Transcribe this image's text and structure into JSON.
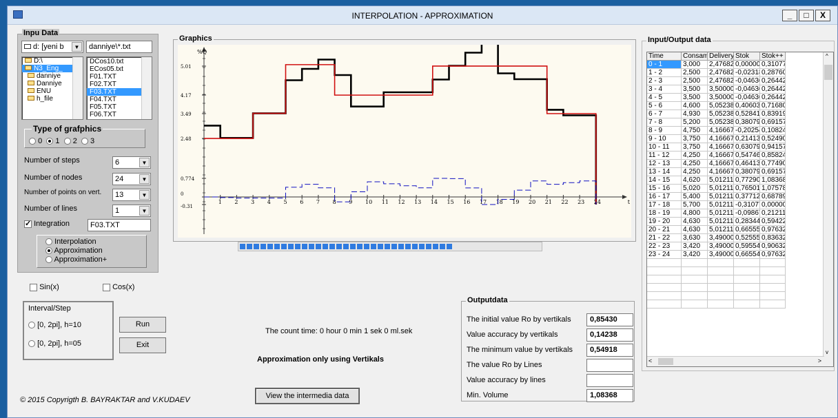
{
  "window": {
    "title": "INTERPOLATION - APPROXIMATION",
    "minimize": "_",
    "maximize": "□",
    "close": "X"
  },
  "input_data": {
    "label": "Inpu Data",
    "drive": "d: [yeni b",
    "filter": "danniye\\*.txt",
    "folders": [
      "D:\\",
      "N3_Eng_",
      "danniye",
      "Danniye",
      "ENU",
      "h_file"
    ],
    "files": [
      "DCos10.txt",
      "ECos05.txt",
      "F01.TXT",
      "F02.TXT",
      "F03.TXT",
      "F04.TXT",
      "F05.TXT",
      "F06.TXT"
    ],
    "selected_file": "F03.TXT",
    "type_label": "Type of grafphics",
    "type_options": [
      "0",
      "1",
      "2",
      "3"
    ],
    "type_selected": "1",
    "steps_label": "Number of steps",
    "steps_value": "6",
    "nodes_label": "Number of nodes",
    "nodes_value": "24",
    "points_label": "Number of points on vert.",
    "points_value": "13",
    "lines_label": "Number of lines",
    "lines_value": "1",
    "integration_label": "Integration",
    "integration_file": "F03.TXT",
    "mode_options": [
      "Interpolation",
      "Approximation",
      "Approximation+"
    ],
    "mode_selected": "Approximation"
  },
  "sin_label": "Sin(x)",
  "cos_label": "Cos(x)",
  "interval": {
    "label": "Interval/Step",
    "options": [
      "[0, 2pi],  h=10",
      "[0, 2pi],  h=05"
    ]
  },
  "run_label": "Run",
  "exit_label": "Exit",
  "count_time": "The count time: 0 hour 0 min 1 sek 0 ml.sek",
  "mode_note": "Approximation only using Vertikals",
  "copyright": "© 2015 Copyrigth B. BAYRAKTAR and V.KUDAEV",
  "view_button": "View the intermedia data",
  "progress": {
    "segments": 31,
    "fraction": 0.71
  },
  "graphics": {
    "label": "Graphics",
    "y_unit": "%Q",
    "y_ticks": [
      "5.01",
      "4.17",
      "3.49",
      "2.48",
      "0.774",
      "0",
      "-0.31"
    ],
    "x_ticks": [
      "1",
      "2",
      "3",
      "4",
      "5",
      "6",
      "7",
      "8",
      "9",
      "10",
      "11",
      "12",
      "13",
      "14",
      "15",
      "16",
      "17",
      "18",
      "19",
      "20",
      "21",
      "22",
      "23",
      "24"
    ],
    "x_unit": "t"
  },
  "chart_data": {
    "type": "line",
    "x": [
      0,
      1,
      2,
      3,
      4,
      5,
      6,
      7,
      8,
      9,
      10,
      11,
      12,
      13,
      14,
      15,
      16,
      17,
      18,
      19,
      20,
      21,
      22,
      23,
      24
    ],
    "y_ticks": [
      5.01,
      4.17,
      3.49,
      2.48,
      0.774,
      0,
      -0.31
    ],
    "series": [
      {
        "color": "#000000",
        "values": [
          3.0,
          2.5,
          2.5,
          3.5,
          3.5,
          4.6,
          4.93,
          5.2,
          4.75,
          3.75,
          3.75,
          4.25,
          4.25,
          4.25,
          4.62,
          5.02,
          5.4,
          5.7,
          4.8,
          4.63,
          4.63,
          3.63,
          3.42,
          3.42
        ]
      },
      {
        "color": "#d01010",
        "values": [
          2.47682,
          2.47682,
          2.47682,
          3.5,
          3.5,
          5.05238,
          5.05238,
          5.05238,
          4.16667,
          4.16667,
          4.16667,
          4.16667,
          4.16667,
          4.16667,
          5.01211,
          5.01211,
          5.01211,
          5.01211,
          5.01211,
          5.01211,
          5.01211,
          3.49,
          3.49,
          3.49
        ]
      },
      {
        "color": "#1010c0",
        "dashed": true,
        "values": [
          0.0,
          -0.02318,
          -0.04636,
          -0.04636,
          -0.04636,
          0.40603,
          0.52841,
          0.38079,
          -0.20254,
          0.21413,
          0.63079,
          0.54746,
          0.46413,
          0.38079,
          0.7729,
          0.76501,
          0.37712,
          -0.31077,
          -0.09867,
          0.28344,
          0.66555,
          0.52555,
          0.59555,
          0.66554
        ]
      }
    ]
  },
  "table": {
    "label": "Input/Output data",
    "headers": [
      "Time",
      "Consamp.",
      "Delivery",
      "Stok",
      "Stok++"
    ],
    "rows": [
      [
        "0 - 1",
        "3,000",
        "2,47682",
        "0,00000",
        "0,31077"
      ],
      [
        "1 - 2",
        "2,500",
        "2,47682",
        "-0,02318",
        "0,28760"
      ],
      [
        "2 - 3",
        "2,500",
        "2,47682",
        "-0,04636",
        "0,26442"
      ],
      [
        "3 - 4",
        "3,500",
        "3,50000",
        "-0,04636",
        "0,26442"
      ],
      [
        "4 - 5",
        "3,500",
        "3,50000",
        "-0,04636",
        "0,26442"
      ],
      [
        "5 - 6",
        "4,600",
        "5,05238",
        "0,40603",
        "0,71680"
      ],
      [
        "6 - 7",
        "4,930",
        "5,05238",
        "0,52841",
        "0,83919"
      ],
      [
        "7 - 8",
        "5,200",
        "5,05238",
        "0,38079",
        "0,69157"
      ],
      [
        "8 - 9",
        "4,750",
        "4,16667",
        "-0,20254",
        "0,10824"
      ],
      [
        "9 - 10",
        "3,750",
        "4,16667",
        "0,21413",
        "0,52490"
      ],
      [
        "10 - 11",
        "3,750",
        "4,16667",
        "0,63079",
        "0,94157"
      ],
      [
        "11 - 12",
        "4,250",
        "4,16667",
        "0,54746",
        "0,85824"
      ],
      [
        "12 - 13",
        "4,250",
        "4,16667",
        "0,46413",
        "0,77490"
      ],
      [
        "13 - 14",
        "4,250",
        "4,16667",
        "0,38079",
        "0,69157"
      ],
      [
        "14 - 15",
        "4,620",
        "5,01211",
        "0,77290",
        "1,08368"
      ],
      [
        "15 - 16",
        "5,020",
        "5,01211",
        "0,76501",
        "1,07578"
      ],
      [
        "16 - 17",
        "5,400",
        "5,01211",
        "0,37712",
        "0,68789"
      ],
      [
        "17 - 18",
        "5,700",
        "5,01211",
        "-0,31077",
        "0,00000"
      ],
      [
        "18 - 19",
        "4,800",
        "5,01211",
        "-0,09867",
        "0,21211"
      ],
      [
        "19 - 20",
        "4,630",
        "5,01211",
        "0,28344",
        "0,59422"
      ],
      [
        "20 - 21",
        "4,630",
        "5,01211",
        "0,66555",
        "0,97632"
      ],
      [
        "21 - 22",
        "3,630",
        "3,49000",
        "0,52555",
        "0,83632"
      ],
      [
        "22 - 23",
        "3,420",
        "3,49000",
        "0,59554",
        "0,90632"
      ],
      [
        "23 - 24",
        "3,420",
        "3,49000",
        "0,66554",
        "0,97632"
      ]
    ]
  },
  "output": {
    "label": "Outputdata",
    "items": [
      {
        "label": "The initial value Ro by vertikals",
        "value": "0,85430"
      },
      {
        "label": "Value accuracy by vertikals",
        "value": "0,14238"
      },
      {
        "label": "The minimum value  by vertikals",
        "value": "0,54918"
      },
      {
        "label": "The value Ro by Lines",
        "value": ""
      },
      {
        "label": "Value accuracy by lines",
        "value": ""
      },
      {
        "label": "Min. Volume",
        "value": "1,08368"
      }
    ]
  }
}
